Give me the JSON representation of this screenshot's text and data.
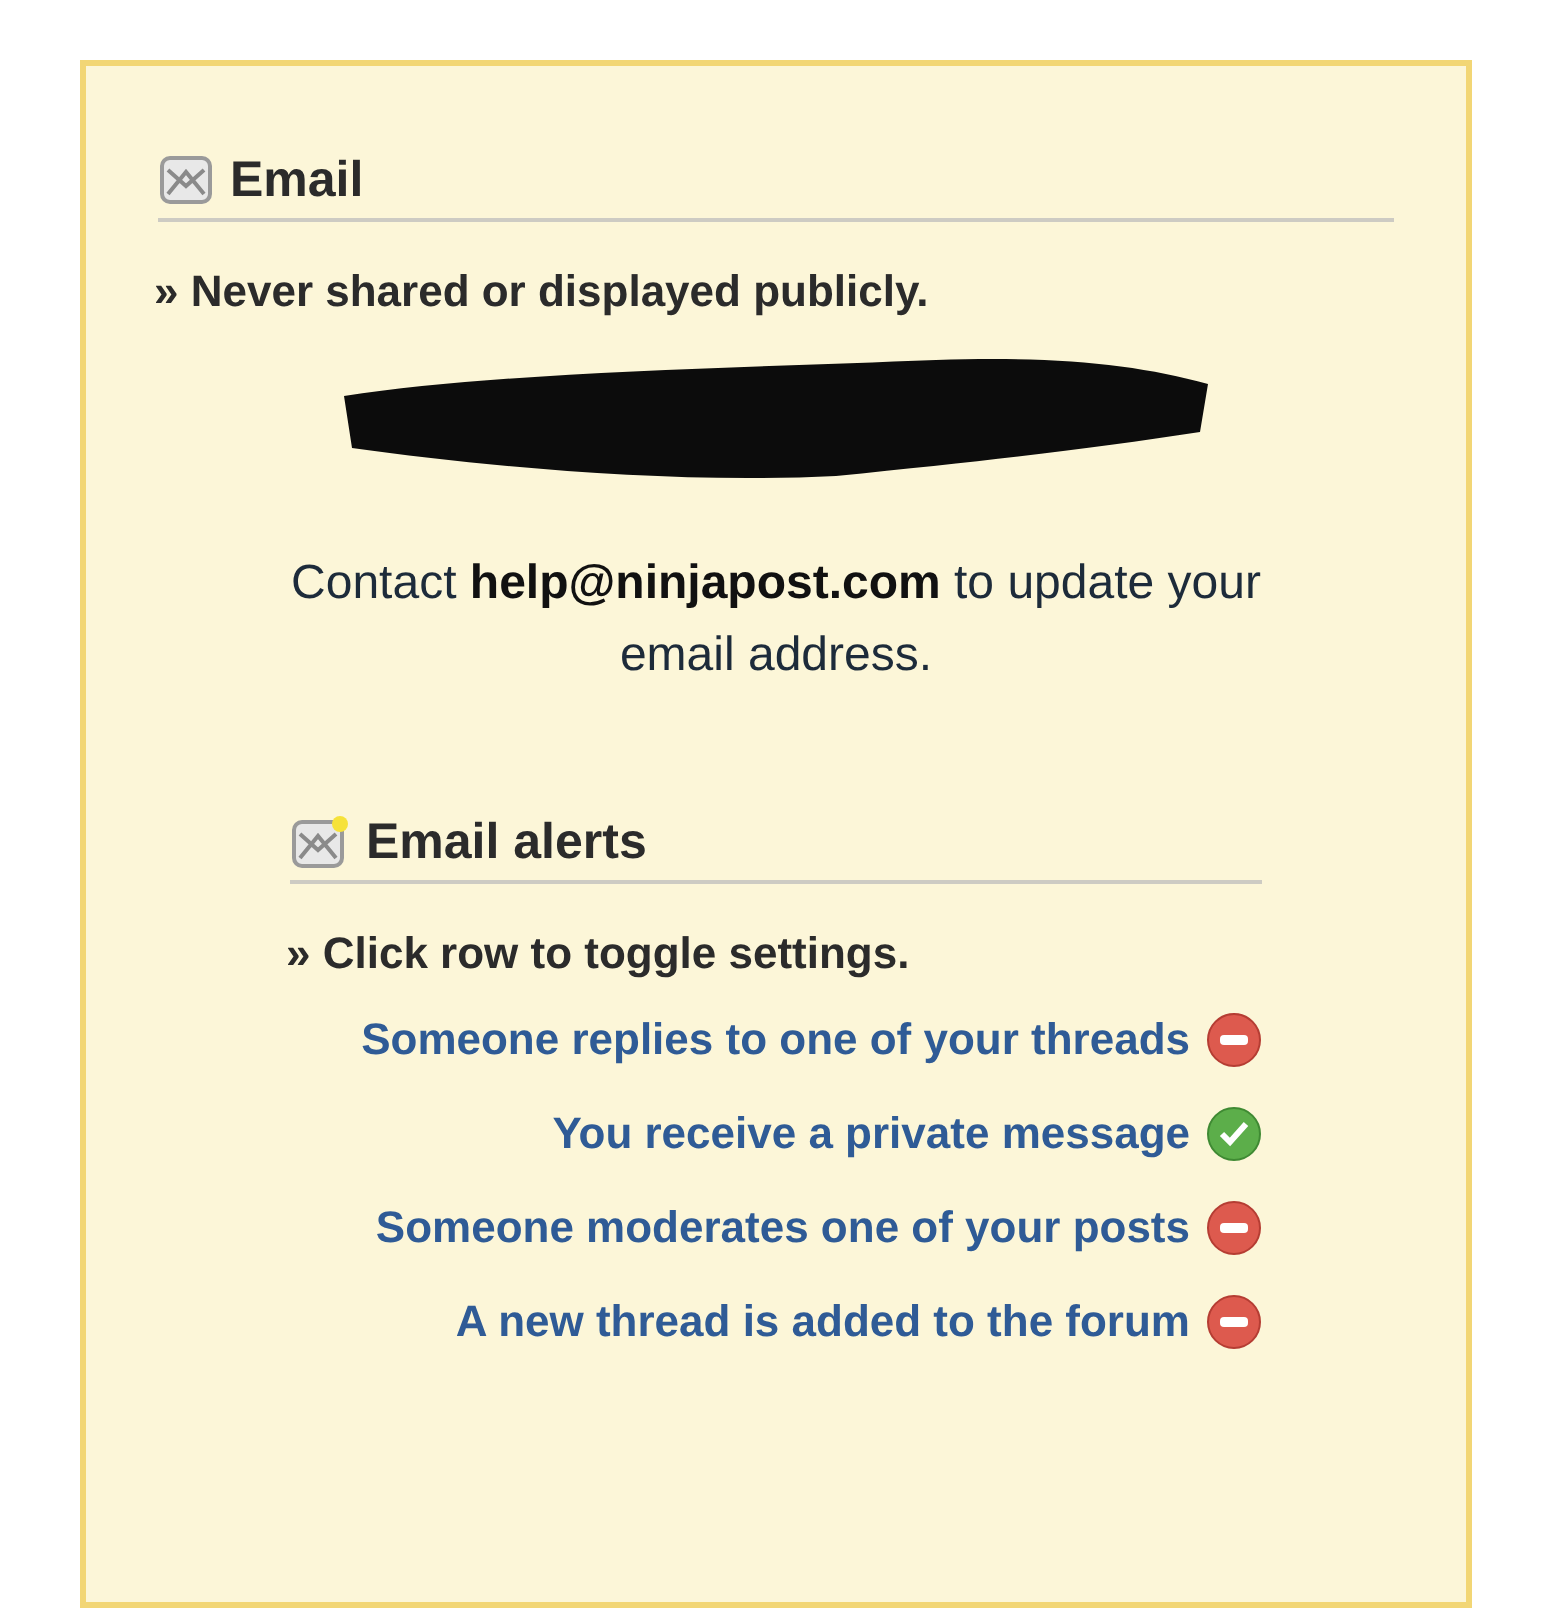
{
  "email": {
    "title": "Email",
    "note": "» Never shared or displayed publicly.",
    "redacted": true,
    "contact": "Contact **help@ninjapost.com** to update your email address."
  },
  "email_alerts": {
    "title": "Email alerts",
    "note": "» Click row to toggle settings.",
    "rows": [
      {
        "label": "Someone replies to one of your threads",
        "on": false
      },
      {
        "label": "You receive a private message",
        "on": true
      },
      {
        "label": "Someone moderates one of your posts",
        "on": false
      },
      {
        "label": "A new thread is added to the forum",
        "on": false
      }
    ]
  }
}
